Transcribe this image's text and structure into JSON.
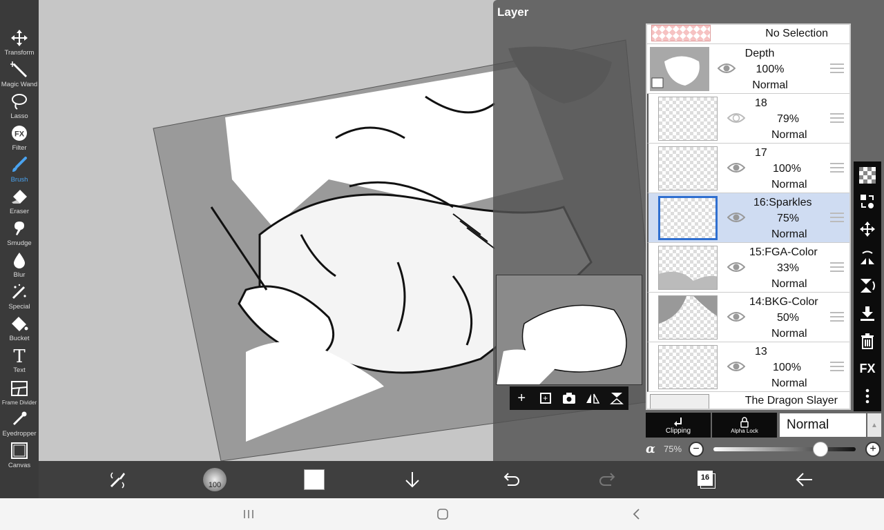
{
  "tools": [
    {
      "label": "Transform",
      "icon": "transform-icon"
    },
    {
      "label": "Magic Wand",
      "icon": "magic-wand-icon"
    },
    {
      "label": "Lasso",
      "icon": "lasso-icon"
    },
    {
      "label": "Filter",
      "icon": "filter-icon"
    },
    {
      "label": "Brush",
      "icon": "brush-icon",
      "active": true
    },
    {
      "label": "Eraser",
      "icon": "eraser-icon"
    },
    {
      "label": "Smudge",
      "icon": "smudge-icon"
    },
    {
      "label": "Blur",
      "icon": "blur-icon"
    },
    {
      "label": "Special",
      "icon": "special-icon"
    },
    {
      "label": "Bucket",
      "icon": "bucket-icon"
    },
    {
      "label": "Text",
      "icon": "text-icon"
    },
    {
      "label": "Frame Divider",
      "icon": "frame-divider-icon"
    },
    {
      "label": "Eyedropper",
      "icon": "eyedropper-icon"
    },
    {
      "label": "Canvas",
      "icon": "canvas-icon"
    }
  ],
  "layer_panel": {
    "title": "Layer",
    "no_selection": "No Selection",
    "layers": [
      {
        "name": "Depth",
        "opacity": "100%",
        "blend": "Normal",
        "folder": true
      },
      {
        "name": "18",
        "opacity": "79%",
        "blend": "Normal"
      },
      {
        "name": "17",
        "opacity": "100%",
        "blend": "Normal"
      },
      {
        "name": "16:Sparkles",
        "opacity": "75%",
        "blend": "Normal",
        "selected": true
      },
      {
        "name": "15:FGA-Color",
        "opacity": "33%",
        "blend": "Normal"
      },
      {
        "name": "14:BKG-Color",
        "opacity": "50%",
        "blend": "Normal"
      },
      {
        "name": "13",
        "opacity": "100%",
        "blend": "Normal"
      }
    ],
    "bottom_folder": "The Dragon Slayer",
    "clipping_label": "Clipping",
    "alpha_lock_label": "Alpha Lock",
    "blend_mode": "Normal",
    "alpha_symbol": "α",
    "alpha_value": "75%",
    "alpha_fraction": 0.75,
    "fx_label": "FX"
  },
  "bottom_bar": {
    "brush_size": "100",
    "color": "#ffffff",
    "layer_count": "16"
  },
  "colors": {
    "accent": "#4aa3f0",
    "selected_layer": "#cfdcf2",
    "selected_border": "#2f6fd0"
  }
}
